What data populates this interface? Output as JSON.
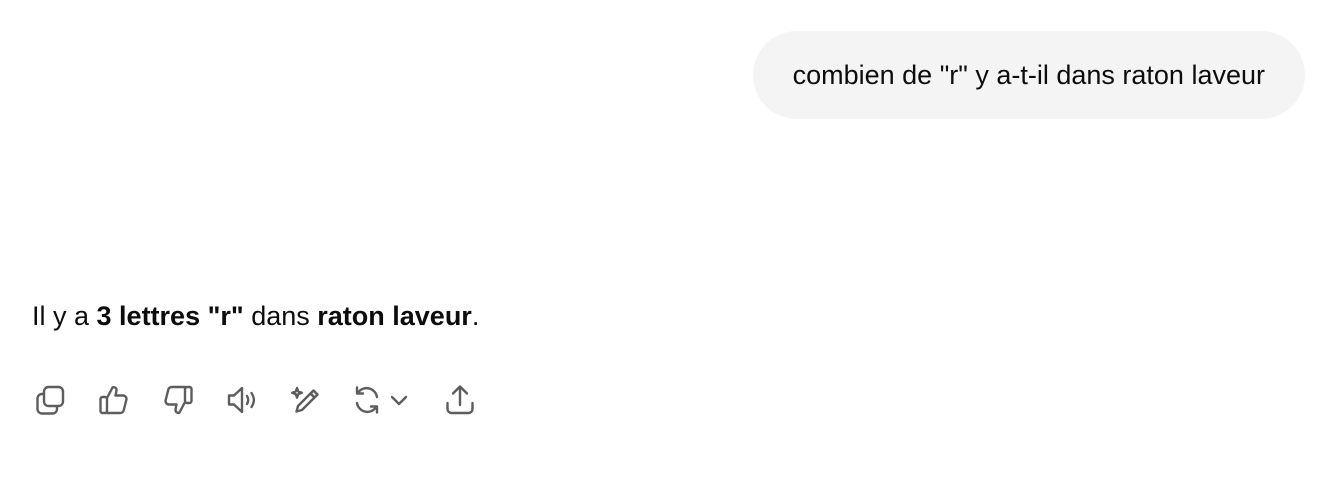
{
  "user_message": {
    "text": "combien de \"r\" y a-t-il dans raton laveur"
  },
  "assistant_message": {
    "part1": "Il y a ",
    "bold1": "3 lettres \"r\"",
    "part2": " dans ",
    "bold2": "raton laveur",
    "part3": "."
  },
  "action_bar": {
    "icons": [
      "copy-icon",
      "thumbs-up-icon",
      "thumbs-down-icon",
      "read-aloud-icon",
      "edit-sparkle-icon",
      "regenerate-icon",
      "chevron-down-icon",
      "share-icon"
    ]
  },
  "colors": {
    "bubble_bg": "#f4f4f4",
    "text": "#0d0d0d",
    "icon": "#5d5d5d"
  }
}
